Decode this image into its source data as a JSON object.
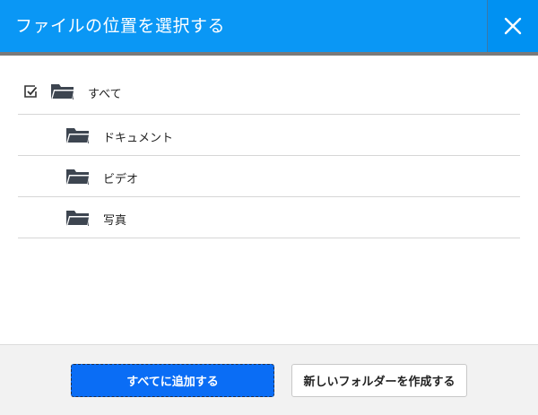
{
  "header": {
    "title": "ファイルの位置を選択する",
    "close_icon": "close-icon"
  },
  "folders": {
    "root": {
      "label": "すべて",
      "checked": true,
      "icon": "folder-icon"
    },
    "children": [
      {
        "label": "ドキュメント",
        "icon": "folder-icon"
      },
      {
        "label": "ビデオ",
        "icon": "folder-icon"
      },
      {
        "label": "写真",
        "icon": "folder-icon"
      }
    ]
  },
  "footer": {
    "primary_button": "すべてに追加する",
    "secondary_button": "新しいフォルダーを作成する"
  },
  "colors": {
    "header_bg": "#0a97f5",
    "primary_button_bg": "#0a6df5",
    "folder_icon": "#3d4550"
  }
}
